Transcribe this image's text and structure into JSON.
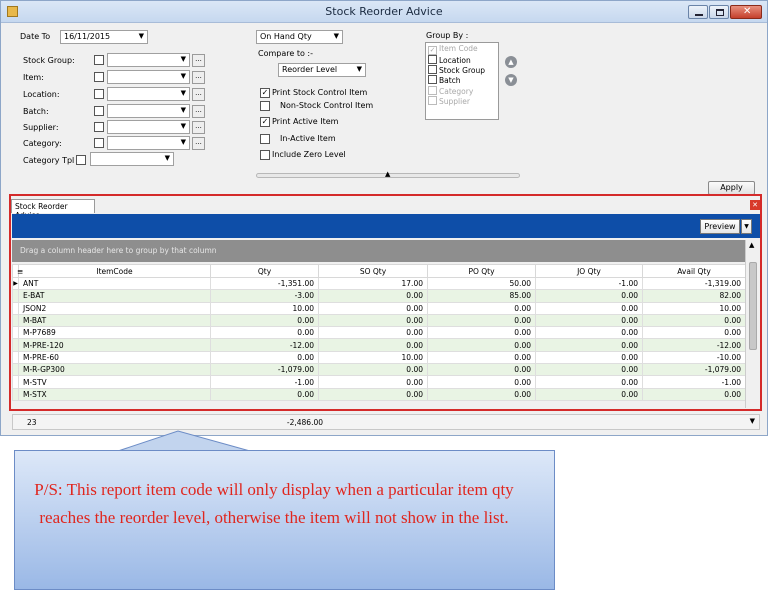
{
  "window": {
    "title": "Stock Reorder Advice"
  },
  "filters": {
    "date_to_label": "Date To",
    "date_to_value": "16/11/2015",
    "stock_group_label": "Stock Group:",
    "item_label": "Item:",
    "location_label": "Location:",
    "batch_label": "Batch:",
    "supplier_label": "Supplier:",
    "category_label": "Category:",
    "category_tpl_label": "Category Tpl :",
    "ellipsis": "..."
  },
  "options": {
    "qty_mode": "On Hand Qty",
    "compare_label": "Compare to :-",
    "compare_value": "Reorder Level",
    "print_stock_control": "Print Stock Control Item",
    "non_stock_control": "Non-Stock Control Item",
    "print_active": "Print Active Item",
    "inactive": "In-Active Item",
    "include_zero": "Include Zero Level"
  },
  "group_by": {
    "label": "Group By :",
    "items": [
      {
        "label": "Item Code",
        "checked": true,
        "disabled": true
      },
      {
        "label": "Location",
        "checked": false,
        "disabled": false
      },
      {
        "label": "Stock Group",
        "checked": false,
        "disabled": false
      },
      {
        "label": "Batch",
        "checked": false,
        "disabled": false
      },
      {
        "label": "Category",
        "checked": false,
        "disabled": true
      },
      {
        "label": "Supplier",
        "checked": false,
        "disabled": true
      }
    ]
  },
  "apply_label": "Apply",
  "report": {
    "tab_label": "Stock Reorder Advice",
    "preview_label": "Preview",
    "group_hint": "Drag a column header here to group by that column",
    "columns": [
      "ItemCode",
      "Qty",
      "SO Qty",
      "PO Qty",
      "JO Qty",
      "Avail Qty"
    ],
    "rows": [
      [
        "ANT",
        "-1,351.00",
        "17.00",
        "50.00",
        "-1.00",
        "-1,319.00"
      ],
      [
        "E-BAT",
        "-3.00",
        "0.00",
        "85.00",
        "0.00",
        "82.00"
      ],
      [
        "JSON2",
        "10.00",
        "0.00",
        "0.00",
        "0.00",
        "10.00"
      ],
      [
        "M-BAT",
        "0.00",
        "0.00",
        "0.00",
        "0.00",
        "0.00"
      ],
      [
        "M-P7689",
        "0.00",
        "0.00",
        "0.00",
        "0.00",
        "0.00"
      ],
      [
        "M-PRE-120",
        "-12.00",
        "0.00",
        "0.00",
        "0.00",
        "-12.00"
      ],
      [
        "M-PRE-60",
        "0.00",
        "10.00",
        "0.00",
        "0.00",
        "-10.00"
      ],
      [
        "M-R-GP300",
        "-1,079.00",
        "0.00",
        "0.00",
        "0.00",
        "-1,079.00"
      ],
      [
        "M-STV",
        "-1.00",
        "0.00",
        "0.00",
        "0.00",
        "-1.00"
      ],
      [
        "M-STX",
        "0.00",
        "0.00",
        "0.00",
        "0.00",
        "0.00"
      ]
    ],
    "footer_count": "23",
    "footer_qty_total": "-2,486.00"
  },
  "callout": {
    "text": "P/S: This report item code will only display when a particular item qty reaches the reorder level, otherwise the item will not show in the list."
  },
  "colors": {
    "accent": "#0e4ea8",
    "highlight": "#d42a2a",
    "row_alt": "#e9f4e4",
    "callout_text": "#e0261e"
  }
}
